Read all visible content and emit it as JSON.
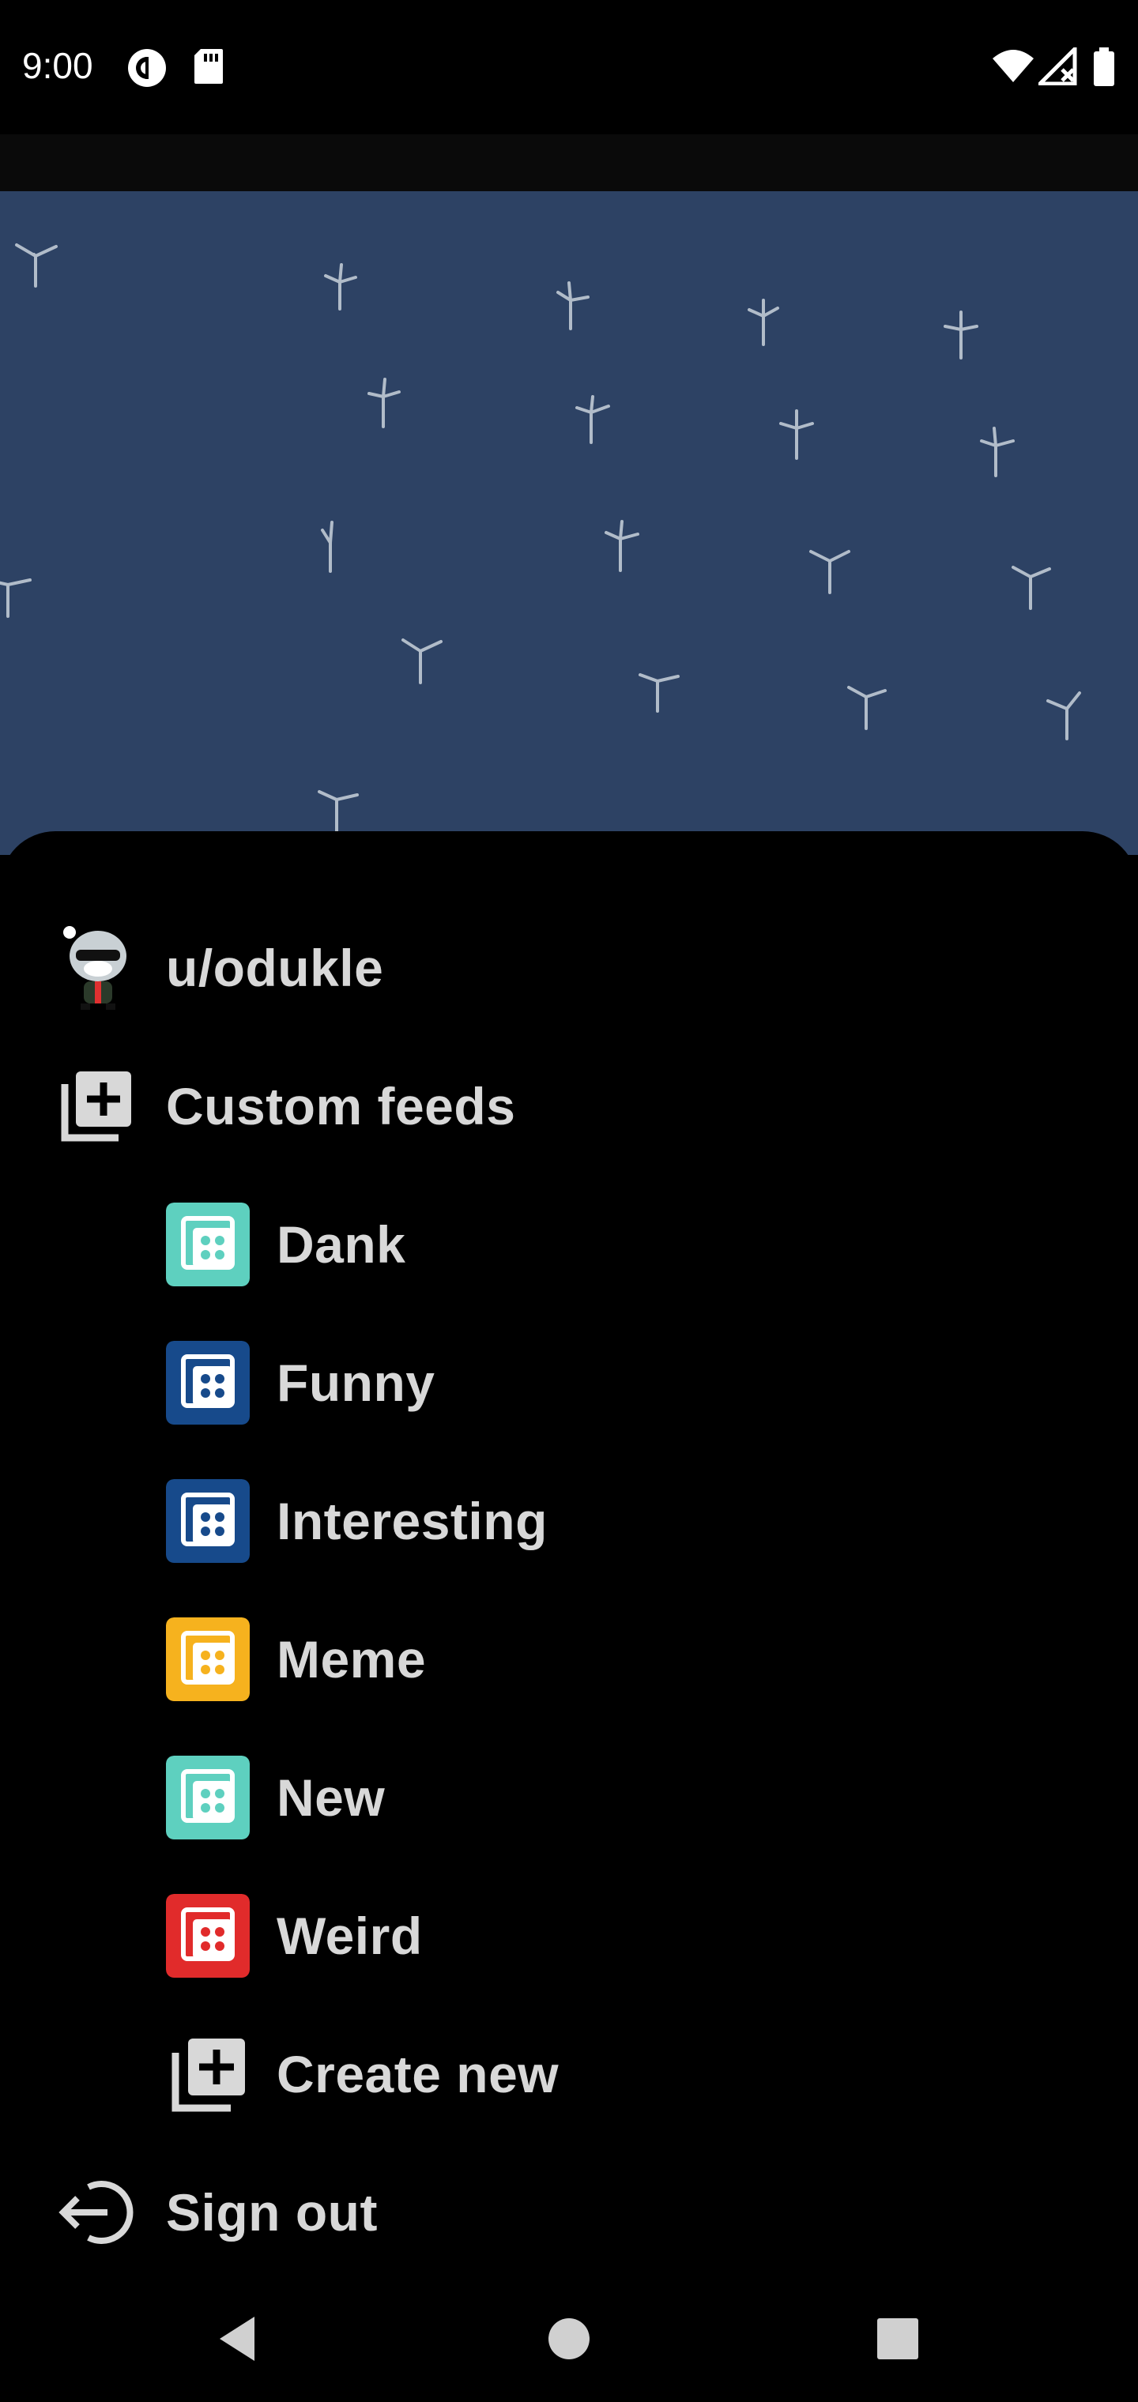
{
  "status_bar": {
    "time": "9:00",
    "icons": [
      "pocket-casts-icon",
      "sd-card-icon",
      "wifi-icon",
      "cellular-no-signal-icon",
      "battery-icon"
    ]
  },
  "account": {
    "username": "u/odukle",
    "avatar_icon": "snoo-avatar-icon"
  },
  "custom_feeds": {
    "label": "Custom feeds",
    "icon": "add-library-icon",
    "items": [
      {
        "label": "Dank",
        "color": "#5ed0bf"
      },
      {
        "label": "Funny",
        "color": "#174a8b"
      },
      {
        "label": "Interesting",
        "color": "#174a8b"
      },
      {
        "label": "Meme",
        "color": "#f6b21e"
      },
      {
        "label": "New",
        "color": "#5ed0bf"
      },
      {
        "label": "Weird",
        "color": "#e12b2b"
      }
    ],
    "create_label": "Create new"
  },
  "sign_out": {
    "label": "Sign out",
    "icon": "logout-icon"
  },
  "nav": {
    "back": "back-icon",
    "home": "home-icon",
    "recents": "recents-icon"
  },
  "colors": {
    "backdrop": "#2d4264",
    "sheet": "#000000",
    "text": "#d8d8d8"
  }
}
